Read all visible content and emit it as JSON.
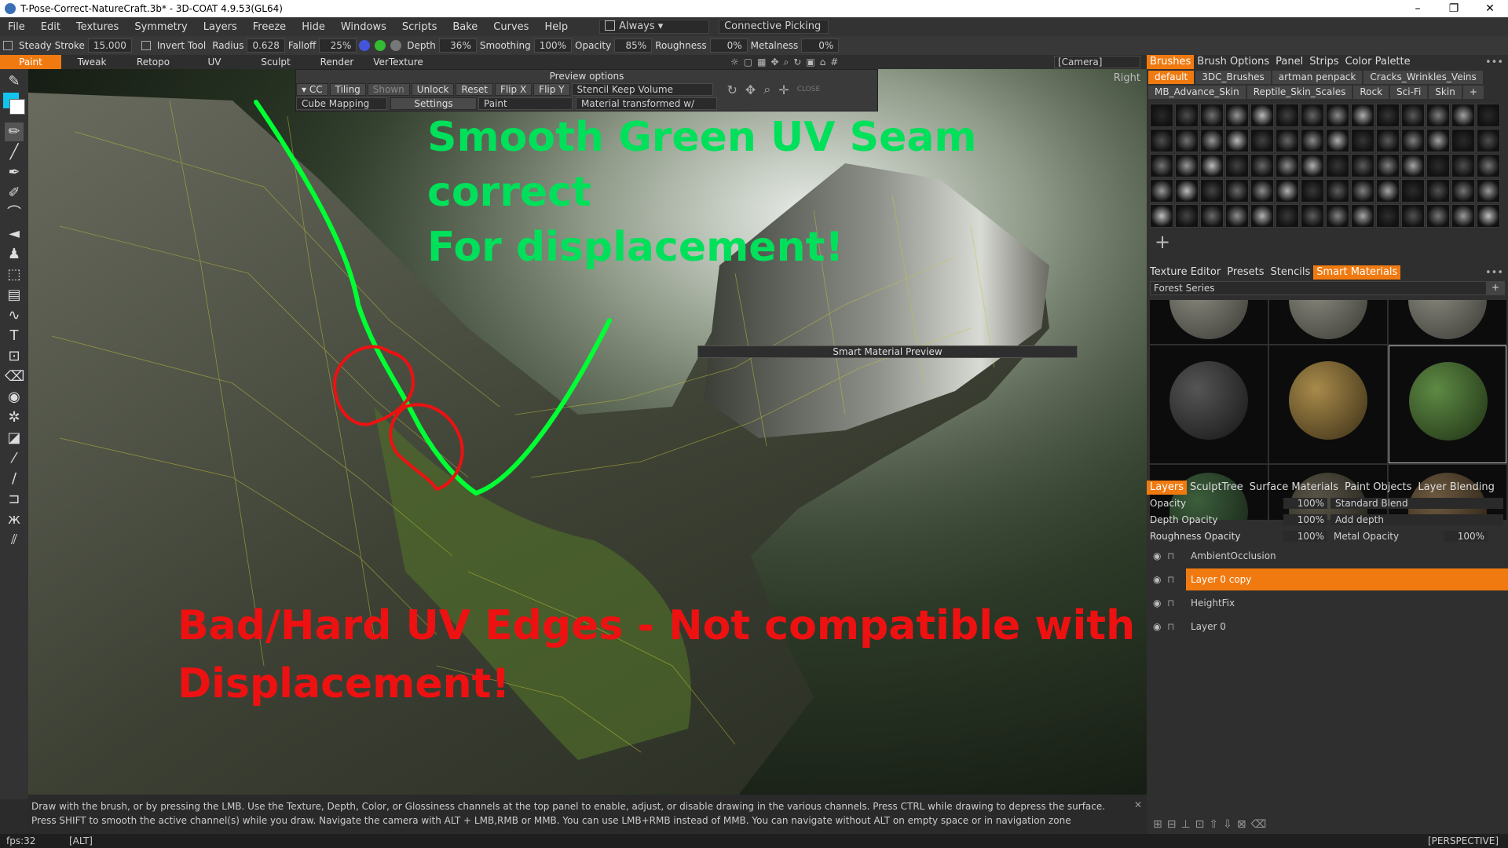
{
  "title": "T-Pose-Correct-NatureCraft.3b* - 3D-COAT 4.9.53(GL64)",
  "menu": [
    "File",
    "Edit",
    "Textures",
    "Symmetry",
    "Layers",
    "Freeze",
    "Hide",
    "Windows",
    "Scripts",
    "Bake",
    "Curves",
    "Help"
  ],
  "menu_always": "Always",
  "menu_picking": "Connective Picking",
  "toolbar": {
    "steady_stroke": "Steady Stroke",
    "steady_value": "15.000",
    "invert_tool": "Invert Tool",
    "radius_label": "Radius",
    "radius_value": "0.628",
    "falloff_label": "Falloff",
    "falloff_value": "25%",
    "depth_label": "Depth",
    "depth_value": "36%",
    "smoothing_label": "Smoothing",
    "smoothing_value": "100%",
    "opacity_label": "Opacity",
    "opacity_value": "85%",
    "roughness_label": "Roughness",
    "roughness_value": "0%",
    "metalness_label": "Metalness",
    "metalness_value": "0%"
  },
  "rooms": [
    "Paint",
    "Tweak",
    "Retopo",
    "UV",
    "Sculpt",
    "Render",
    "VerTexture"
  ],
  "camera": "[Camera]",
  "preview": {
    "title": "Preview options",
    "cc": "CC",
    "tiling": "Tiling",
    "shown": "Shown",
    "unlock": "Unlock",
    "reset": "Reset",
    "flipx": "Flip X",
    "flipy": "Flip Y",
    "stencil_mode": "Stencil Keep Volume",
    "mapping": "Cube Mapping",
    "settings": "Settings",
    "paint": "Paint",
    "material_mode": "Material transformed w/",
    "close": "CLOSE"
  },
  "viewport_label": "Right",
  "smart_material_preview": "Smart Material Preview",
  "annotations": {
    "green_line1": "Smooth Green UV Seam correct",
    "green_line2": "For displacement!",
    "red_line1": "Bad/Hard UV Edges - Not compatible with",
    "red_line2": "Displacement!"
  },
  "status_text": "Draw with the brush, or by pressing the LMB. Use the Texture, Depth, Color, or Glossiness channels at the top panel to enable, adjust, or disable drawing in the various channels. Press CTRL while drawing to depress the surface. Press SHIFT to smooth the active channel(s) while you draw. Navigate the camera with ALT + LMB,RMB or MMB. You can use LMB+RMB instead of MMB. You can navigate without ALT on empty space or in navigation zone",
  "fps": "fps:32",
  "alt": "[ALT]",
  "perspective": "[PERSPECTIVE]",
  "brush_tabs": [
    "Brushes",
    "Brush Options",
    "Panel",
    "Strips",
    "Color Palette"
  ],
  "brush_packs": [
    "default",
    "3DC_Brushes",
    "artman penpack",
    "Cracks_Wrinkles_Veins",
    "MB_Advance_Skin",
    "Reptile_Skin_Scales",
    "Rock",
    "Sci-Fi",
    "Skin",
    "+"
  ],
  "mat_tabs": [
    "Texture Editor",
    "Presets",
    "Stencils",
    "Smart Materials"
  ],
  "mat_series": "Forest Series",
  "layer_tabs": [
    "Layers",
    "SculptTree",
    "Surface Materials",
    "Paint Objects",
    "Layer Blending"
  ],
  "layer_props": {
    "opacity": "Opacity",
    "opacity_val": "100%",
    "blend": "Standard Blend",
    "depth_opacity": "Depth Opacity",
    "depth_val": "100%",
    "depth_blend": "Add depth",
    "rough_opacity": "Roughness Opacity",
    "rough_val": "100%",
    "metal_opacity": "Metal Opacity",
    "metal_val": "100%"
  },
  "layers": [
    "AmbientOcclusion",
    "Layer 0 copy",
    "HeightFix",
    "Layer 0"
  ],
  "colors": {
    "accent": "#f07a10",
    "green_note": "#00e05a",
    "red_note": "#ee1111",
    "primary_swatch": "#11c5f0"
  }
}
